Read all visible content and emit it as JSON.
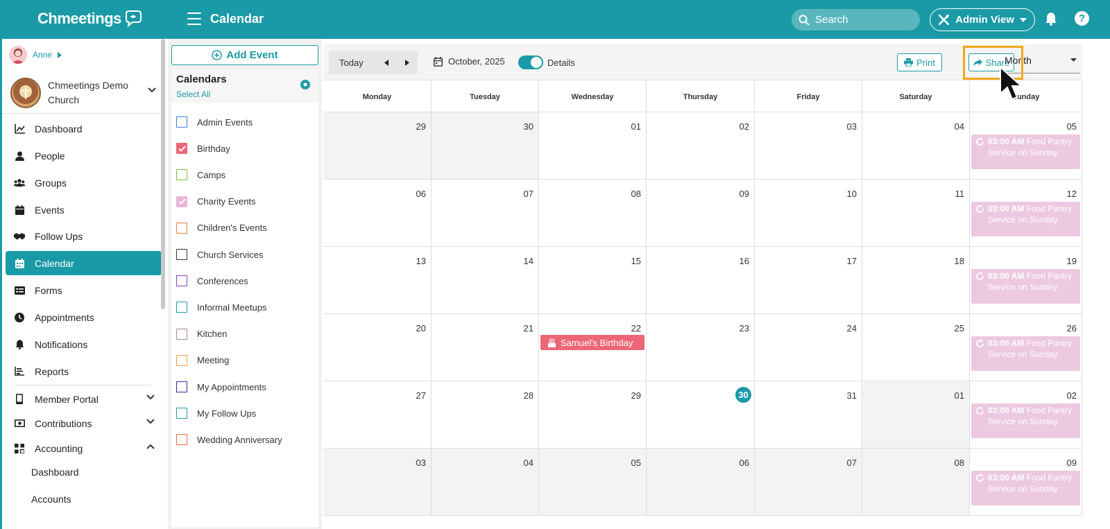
{
  "app": {
    "brand": "Chmeetings",
    "page_title": "Calendar"
  },
  "topbar": {
    "search_placeholder": "Search",
    "admin_view_label": "Admin View"
  },
  "user": {
    "name": "Anne"
  },
  "church": {
    "name": "Chmeetings Demo Church"
  },
  "nav": {
    "items": [
      {
        "label": "Dashboard",
        "icon": "chart-line-icon"
      },
      {
        "label": "People",
        "icon": "person-icon"
      },
      {
        "label": "Groups",
        "icon": "group-icon"
      },
      {
        "label": "Events",
        "icon": "calendar-icon"
      },
      {
        "label": "Follow Ups",
        "icon": "handshake-icon"
      },
      {
        "label": "Calendar",
        "icon": "calendar-grid-icon",
        "active": true
      },
      {
        "label": "Forms",
        "icon": "form-icon"
      },
      {
        "label": "Appointments",
        "icon": "clock-icon"
      },
      {
        "label": "Notifications",
        "icon": "bell-icon"
      },
      {
        "label": "Reports",
        "icon": "bar-chart-icon"
      }
    ],
    "sections": [
      {
        "label": "Member Portal",
        "icon": "phone-icon",
        "expanded": false
      },
      {
        "label": "Contributions",
        "icon": "money-icon",
        "expanded": false
      },
      {
        "label": "Accounting",
        "icon": "apps-icon",
        "expanded": true
      }
    ],
    "accounting_sub": [
      "Dashboard",
      "Accounts"
    ]
  },
  "calendars_panel": {
    "add_event_label": "Add Event",
    "title": "Calendars",
    "select_all_label": "Select All",
    "items": [
      {
        "label": "Admin Events",
        "color": "#3b7bd8",
        "checked": false
      },
      {
        "label": "Birthday",
        "color": "#ec6677",
        "checked": true
      },
      {
        "label": "Camps",
        "color": "#7cbb3e",
        "checked": false
      },
      {
        "label": "Charity Events",
        "color": "#e9b6d6",
        "checked": true
      },
      {
        "label": "Children's Events",
        "color": "#ec7a3a",
        "checked": false
      },
      {
        "label": "Church Services",
        "color": "#333333",
        "checked": false
      },
      {
        "label": "Conferences",
        "color": "#8e3ab8",
        "checked": false
      },
      {
        "label": "Informal Meetups",
        "color": "#1a9aa6",
        "checked": false
      },
      {
        "label": "Kitchen",
        "color": "#a08e84",
        "checked": false
      },
      {
        "label": "Meeting",
        "color": "#f0a23a",
        "checked": false
      },
      {
        "label": "My Appointments",
        "color": "#2b2e8f",
        "checked": false
      },
      {
        "label": "My Follow Ups",
        "color": "#1a9aa6",
        "checked": false
      },
      {
        "label": "Wedding Anniversary",
        "color": "#ec6a3a",
        "checked": false
      }
    ]
  },
  "toolbar": {
    "today_label": "Today",
    "date_label": "October, 2025",
    "details_label": "Details",
    "details_on": true,
    "print_label": "Print",
    "share_label": "Share",
    "view_selected": "Month"
  },
  "calendar": {
    "weekdays": [
      "Monday",
      "Tuesday",
      "Wednesday",
      "Thursday",
      "Friday",
      "Saturday",
      "Sunday"
    ],
    "weeks": [
      [
        "29",
        "30",
        "01",
        "02",
        "03",
        "04",
        "05"
      ],
      [
        "06",
        "07",
        "08",
        "09",
        "10",
        "11",
        "12"
      ],
      [
        "13",
        "14",
        "15",
        "16",
        "17",
        "18",
        "19"
      ],
      [
        "20",
        "21",
        "22",
        "23",
        "24",
        "25",
        "26"
      ],
      [
        "27",
        "28",
        "29",
        "30",
        "31",
        "01",
        "02"
      ],
      [
        "03",
        "04",
        "05",
        "06",
        "07",
        "08",
        "09"
      ]
    ],
    "muted_cells": [
      [
        0,
        0
      ],
      [
        0,
        1
      ],
      [
        4,
        5
      ],
      [
        5,
        0
      ],
      [
        5,
        1
      ],
      [
        5,
        2
      ],
      [
        5,
        3
      ],
      [
        5,
        4
      ],
      [
        5,
        5
      ]
    ],
    "today_cell": [
      4,
      3
    ],
    "recurring_event": {
      "time": "03:00 AM",
      "title": "Food Pantry Service on Sunday"
    },
    "birthday_event": {
      "title": "Samuel's Birthday",
      "week": 3,
      "day": 2
    }
  },
  "colors": {
    "accent": "#1a9aa6",
    "highlight": "#f1a91c",
    "birthday": "#ec6677",
    "charity": "#ecc9e0"
  }
}
